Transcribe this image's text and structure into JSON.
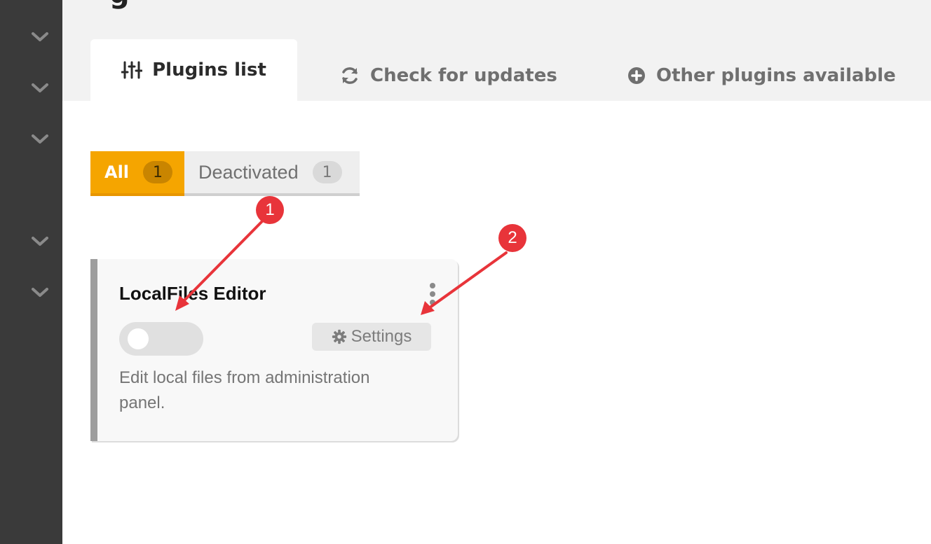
{
  "sidebar": {
    "items": [
      {
        "icon": "chevron-down-icon"
      },
      {
        "icon": "chevron-down-icon"
      },
      {
        "icon": "chevron-down-icon"
      },
      {
        "icon": "chevron-down-icon"
      },
      {
        "icon": "chevron-down-icon"
      }
    ]
  },
  "header": {
    "title_fragment": "g"
  },
  "tabs": {
    "plugins_list": "Plugins list",
    "check_updates": "Check for updates",
    "other_plugins": "Other plugins available"
  },
  "filters": {
    "all": {
      "label": "All",
      "count": "1"
    },
    "deactivated": {
      "label": "Deactivated",
      "count": "1"
    }
  },
  "plugin": {
    "name": "LocalFiles Editor",
    "settings_label": "Settings",
    "description": "Edit local files from administration panel."
  },
  "annotations": {
    "marker_1": "1",
    "marker_2": "2"
  },
  "colors": {
    "accent": "#f5a500",
    "sidebar": "#3a3a3a",
    "marker": "#e8343a"
  }
}
